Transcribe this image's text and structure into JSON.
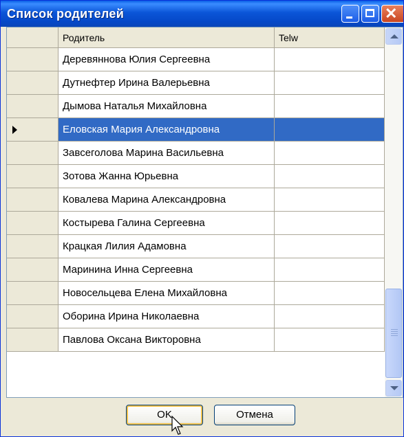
{
  "window": {
    "title": "Список родителей"
  },
  "columns": {
    "parent": "Родитель",
    "tel": "Telw"
  },
  "rows": [
    {
      "name": "Деревяннова Юлия Сергеевна",
      "tel": ""
    },
    {
      "name": "Дутнефтер Ирина Валерьевна",
      "tel": ""
    },
    {
      "name": "Дымова Наталья Михайловна",
      "tel": ""
    },
    {
      "name": "Еловская Мария Александровна",
      "tel": ""
    },
    {
      "name": "Завсеголова Марина Васильевна",
      "tel": ""
    },
    {
      "name": "Зотова Жанна Юрьевна",
      "tel": ""
    },
    {
      "name": "Ковалева Марина Александровна",
      "tel": ""
    },
    {
      "name": "Костырева Галина Сергеевна",
      "tel": ""
    },
    {
      "name": "Крацкая Лилия Адамовна",
      "tel": ""
    },
    {
      "name": "Маринина Инна Сергеевна",
      "tel": ""
    },
    {
      "name": "Новосельцева Елена Михайловна",
      "tel": ""
    },
    {
      "name": "Оборина Ирина Николаевна",
      "tel": ""
    },
    {
      "name": "Павлова Оксана Викторовна",
      "tel": ""
    }
  ],
  "selected_row_index": 3,
  "buttons": {
    "ok": "OK",
    "cancel": "Отмена"
  },
  "colors": {
    "selection": "#316ac5",
    "titlebar": "#0a5fe5",
    "dialog_bg": "#ece9d8"
  }
}
